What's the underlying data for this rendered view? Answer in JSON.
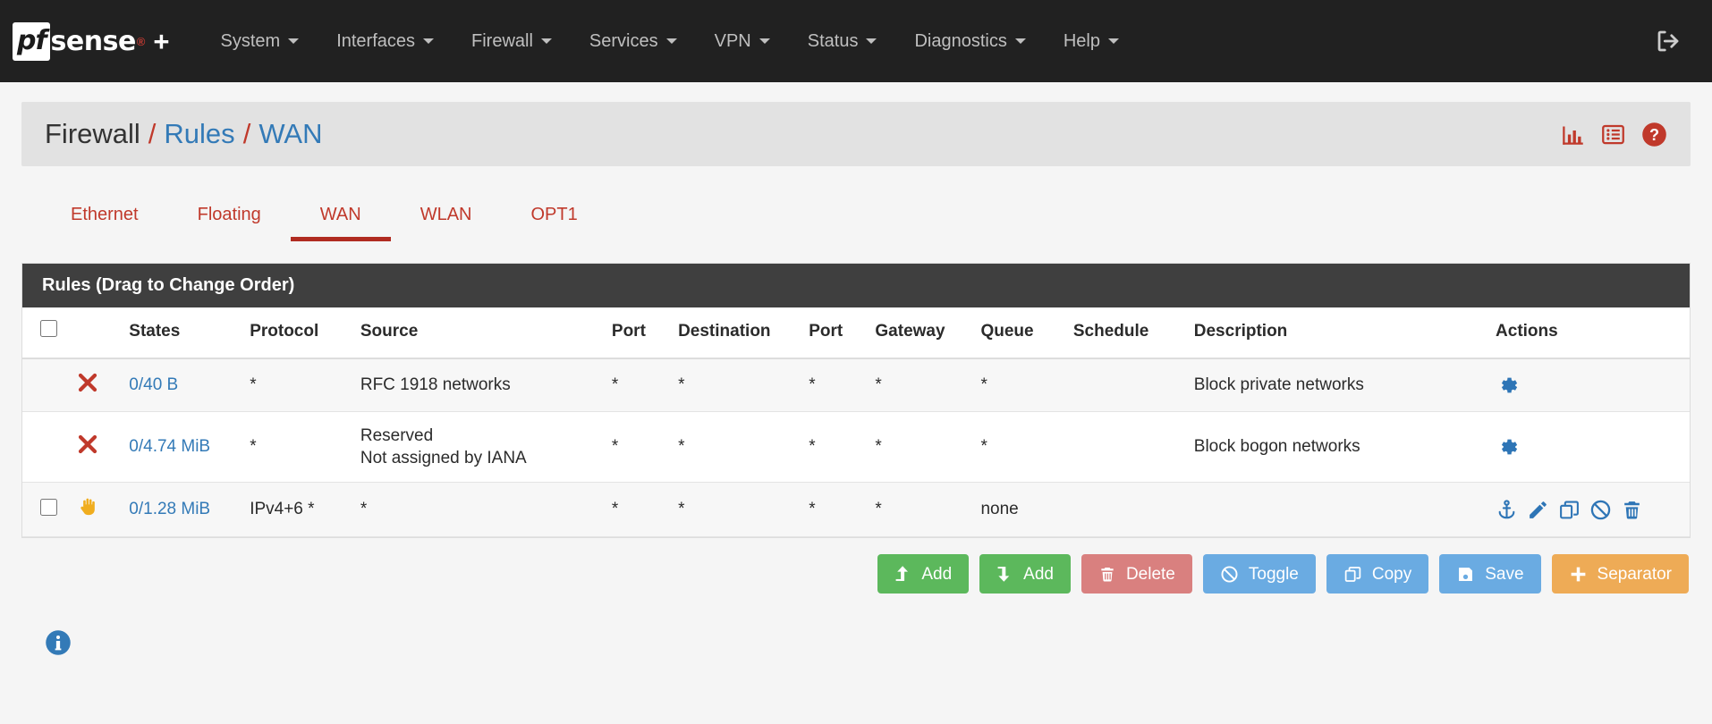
{
  "navbar": {
    "brand": {
      "mark": "pf",
      "word": "sense",
      "reg": "®",
      "plus": "+"
    },
    "items": [
      {
        "label": "System",
        "icon": "chevron-down-icon"
      },
      {
        "label": "Interfaces",
        "icon": "chevron-down-icon"
      },
      {
        "label": "Firewall",
        "icon": "chevron-down-icon"
      },
      {
        "label": "Services",
        "icon": "chevron-down-icon"
      },
      {
        "label": "VPN",
        "icon": "chevron-down-icon"
      },
      {
        "label": "Status",
        "icon": "chevron-down-icon"
      },
      {
        "label": "Diagnostics",
        "icon": "chevron-down-icon"
      },
      {
        "label": "Help",
        "icon": "chevron-down-icon"
      }
    ],
    "logout_icon": "logout-icon"
  },
  "breadcrumb": {
    "root": "Firewall",
    "sep1": "/",
    "link1": "Rules",
    "sep2": "/",
    "link2": "WAN",
    "icons": [
      "chart-icon",
      "list-icon",
      "help-circle-icon"
    ],
    "icon_color": "#c0392b"
  },
  "tabs": [
    {
      "label": "Ethernet",
      "active": false
    },
    {
      "label": "Floating",
      "active": false
    },
    {
      "label": "WAN",
      "active": true
    },
    {
      "label": "WLAN",
      "active": false
    },
    {
      "label": "OPT1",
      "active": false
    }
  ],
  "panel": {
    "title": "Rules (Drag to Change Order)",
    "headers": {
      "select_all": "",
      "states": "States",
      "protocol": "Protocol",
      "source": "Source",
      "port": "Port",
      "destination": "Destination",
      "port2": "Port",
      "gateway": "Gateway",
      "queue": "Queue",
      "schedule": "Schedule",
      "description": "Description",
      "actions": "Actions"
    },
    "rows": [
      {
        "has_checkbox": false,
        "status_icon": "block-x-icon",
        "status_color": "#c0392b",
        "states": "0/40 B",
        "protocol": "*",
        "source": "RFC 1918 networks",
        "source_line2": "",
        "port": "*",
        "destination": "*",
        "port2": "*",
        "gateway": "*",
        "queue": "*",
        "schedule": "",
        "description": "Block private networks",
        "actions": [
          "gear-icon"
        ],
        "striped": true
      },
      {
        "has_checkbox": false,
        "status_icon": "block-x-icon",
        "status_color": "#c0392b",
        "states": "0/4.74 MiB",
        "protocol": "*",
        "source": "Reserved",
        "source_line2": "Not assigned by IANA",
        "port": "*",
        "destination": "*",
        "port2": "*",
        "gateway": "*",
        "queue": "*",
        "schedule": "",
        "description": "Block bogon networks",
        "actions": [
          "gear-icon"
        ],
        "striped": false
      },
      {
        "has_checkbox": true,
        "status_icon": "reject-hand-icon",
        "status_color": "#f0ad1e",
        "states": "0/1.28 MiB",
        "protocol": "IPv4+6 *",
        "source": "*",
        "source_line2": "",
        "port": "*",
        "destination": "*",
        "port2": "*",
        "gateway": "*",
        "queue": "none",
        "schedule": "",
        "description": "",
        "actions": [
          "anchor-icon",
          "pencil-icon",
          "copy-icon",
          "ban-icon",
          "trash-icon"
        ],
        "striped": true
      }
    ]
  },
  "buttons": [
    {
      "label": "Add",
      "icon": "arrow-up-icon",
      "color": "green"
    },
    {
      "label": "Add",
      "icon": "arrow-down-icon",
      "color": "green"
    },
    {
      "label": "Delete",
      "icon": "trash-icon",
      "color": "red"
    },
    {
      "label": "Toggle",
      "icon": "ban-icon",
      "color": "blue"
    },
    {
      "label": "Copy",
      "icon": "copy-icon",
      "color": "blue"
    },
    {
      "label": "Save",
      "icon": "save-icon",
      "color": "blue"
    },
    {
      "label": "Separator",
      "icon": "plus-icon",
      "color": "orange"
    }
  ],
  "footer": {
    "info_icon": "info-circle-icon",
    "info_color": "#337ab7"
  }
}
